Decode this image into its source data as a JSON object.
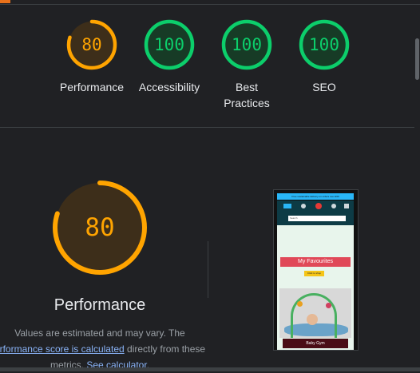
{
  "colors": {
    "background": "#202124",
    "score_average": "#ffa400",
    "score_good": "#0cce6b",
    "text": "#e8eaed",
    "link": "#8ab4f8"
  },
  "gauges": [
    {
      "label": "Performance",
      "score": "80",
      "status": "average"
    },
    {
      "label": "Accessibility",
      "score": "100",
      "status": "good"
    },
    {
      "label": "Best Practices",
      "score": "100",
      "status": "good"
    },
    {
      "label": "SEO",
      "score": "100",
      "status": "good"
    }
  ],
  "performance": {
    "score": "80",
    "title": "Performance",
    "note_prefix": "Values are estimated and may vary. The",
    "note_link1": "erformance score is calculated",
    "note_mid": "directly from these",
    "note_suffix": "metrics.",
    "note_link2": "See calculator."
  },
  "screenshot": {
    "banner": "Free sustainable delivery on orders over £60",
    "search_placeholder": "Search",
    "favourites": "My Favourites",
    "shop_button": "Click to shop",
    "caption": "Baby Gym"
  }
}
